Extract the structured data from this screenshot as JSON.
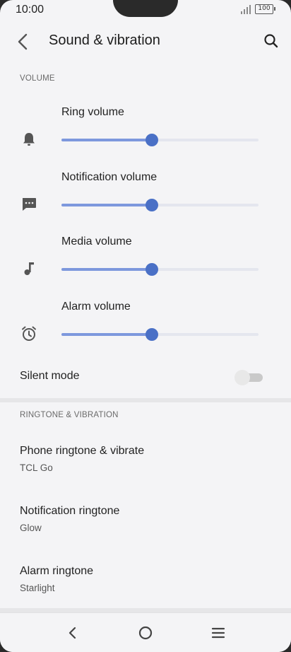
{
  "status_bar": {
    "time": "10:00",
    "battery": "100"
  },
  "app_bar": {
    "title": "Sound & vibration",
    "back_icon": "arrow-back-icon",
    "search_icon": "search-icon"
  },
  "volume_section": {
    "header": "VOLUME",
    "sliders": [
      {
        "label": "Ring volume",
        "icon": "bell-icon",
        "level_percent": 46
      },
      {
        "label": "Notification volume",
        "icon": "message-icon",
        "level_percent": 46
      },
      {
        "label": "Media volume",
        "icon": "music-note-icon",
        "level_percent": 46
      },
      {
        "label": "Alarm volume",
        "icon": "alarm-icon",
        "level_percent": 46
      }
    ],
    "colors": {
      "accent": "#4a70c6",
      "fill": "#7d98dd",
      "track": "#e4e6ee"
    }
  },
  "silent_mode": {
    "label": "Silent mode",
    "enabled": false
  },
  "ringtone_section": {
    "header": "RINGTONE & VIBRATION",
    "items": [
      {
        "title": "Phone ringtone & vibrate",
        "subtitle": "TCL Go"
      },
      {
        "title": "Notification ringtone",
        "subtitle": "Glow"
      },
      {
        "title": "Alarm ringtone",
        "subtitle": "Starlight"
      }
    ]
  },
  "nav_bar": {
    "back": "nav-back-icon",
    "home": "nav-home-icon",
    "recents": "nav-menu-icon"
  }
}
